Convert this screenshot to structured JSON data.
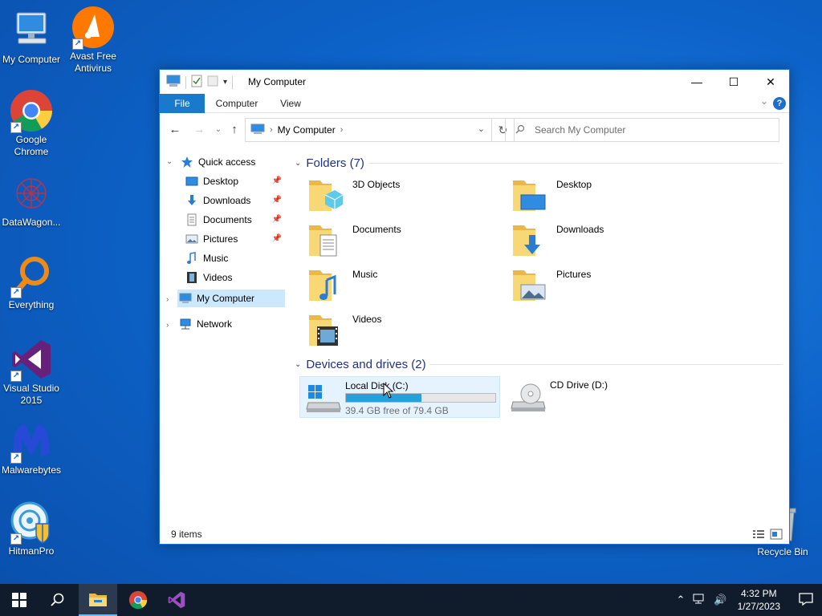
{
  "desktop": {
    "icons": [
      {
        "label": "My Computer"
      },
      {
        "label": "Avast Free Antivirus"
      },
      {
        "label": "Google Chrome"
      },
      {
        "label": "DataWagon..."
      },
      {
        "label": "Everything"
      },
      {
        "label": "Visual Studio 2015"
      },
      {
        "label": "Malwarebytes"
      },
      {
        "label": "HitmanPro"
      },
      {
        "label": "Recycle Bin"
      }
    ]
  },
  "window": {
    "title": "My Computer",
    "controls": {
      "minimize": "—",
      "maximize": "☐",
      "close": "✕"
    },
    "ribbon": {
      "file": "File",
      "computer": "Computer",
      "view": "View",
      "help": "?"
    },
    "address": {
      "location": "My Computer"
    },
    "search": {
      "placeholder": "Search My Computer"
    },
    "nav": {
      "quick_access": "Quick access",
      "items": [
        {
          "label": "Desktop",
          "pinned": true
        },
        {
          "label": "Downloads",
          "pinned": true
        },
        {
          "label": "Documents",
          "pinned": true
        },
        {
          "label": "Pictures",
          "pinned": true
        },
        {
          "label": "Music",
          "pinned": false
        },
        {
          "label": "Videos",
          "pinned": false
        }
      ],
      "my_computer": "My Computer",
      "network": "Network"
    },
    "folders": {
      "header": "Folders (7)",
      "items": [
        "3D Objects",
        "Desktop",
        "Documents",
        "Downloads",
        "Music",
        "Pictures",
        "Videos"
      ]
    },
    "drives": {
      "header": "Devices and drives (2)",
      "items": [
        {
          "name": "Local Disk (C:)",
          "free_text": "39.4 GB free of 79.4 GB",
          "used_fraction": 0.504
        },
        {
          "name": "CD Drive (D:)"
        }
      ]
    },
    "status": {
      "count": "9 items"
    }
  },
  "taskbar": {
    "clock_time": "4:32 PM",
    "clock_date": "1/27/2023"
  },
  "colors": {
    "accent": "#1979ca",
    "selection": "#cce8ff",
    "progress": "#26a0da"
  }
}
